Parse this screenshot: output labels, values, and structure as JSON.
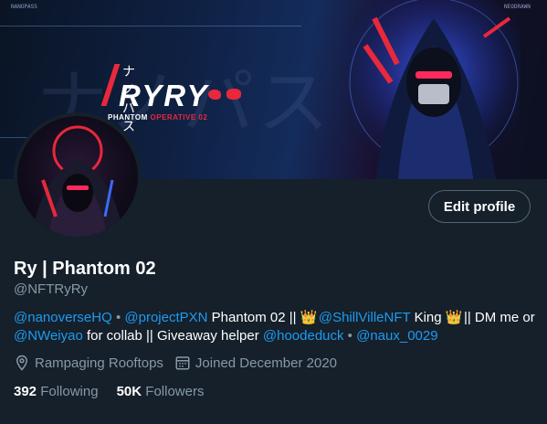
{
  "banner": {
    "jp_bg": "ナノパス",
    "jp_small": "ナノパス",
    "brand_name": "RYRY",
    "subtitle_main": "PHANTOM",
    "subtitle_accent": "OPERATIVE 02",
    "hud_left": "NANOPASS",
    "hud_right": "NEODRAWN"
  },
  "profile": {
    "display_name": "Ry | Phantom 02",
    "handle": "@NFTRyRy",
    "edit_button": "Edit profile",
    "bio": {
      "mention_1": "@nanoverseHQ",
      "sep_1": "•",
      "mention_2": "@projectPXN",
      "text_1": "Phantom 02 ||",
      "crown": "👑",
      "mention_3": "@ShillVilleNFT",
      "text_2": "King",
      "text_3": "|| DM me or",
      "mention_4": "@NWeiyao",
      "text_4": "for collab || Giveaway helper",
      "mention_5": "@hoodeduck",
      "sep_2": "•",
      "mention_6": "@naux_0029"
    },
    "location": "Rampaging Rooftops",
    "joined": "Joined December 2020",
    "following_count": "392",
    "following_label": "Following",
    "followers_count": "50K",
    "followers_label": "Followers"
  },
  "colors": {
    "background": "#15202b",
    "accent": "#1d9bf0",
    "muted": "#8899a6",
    "brand_red": "#e8283b"
  }
}
